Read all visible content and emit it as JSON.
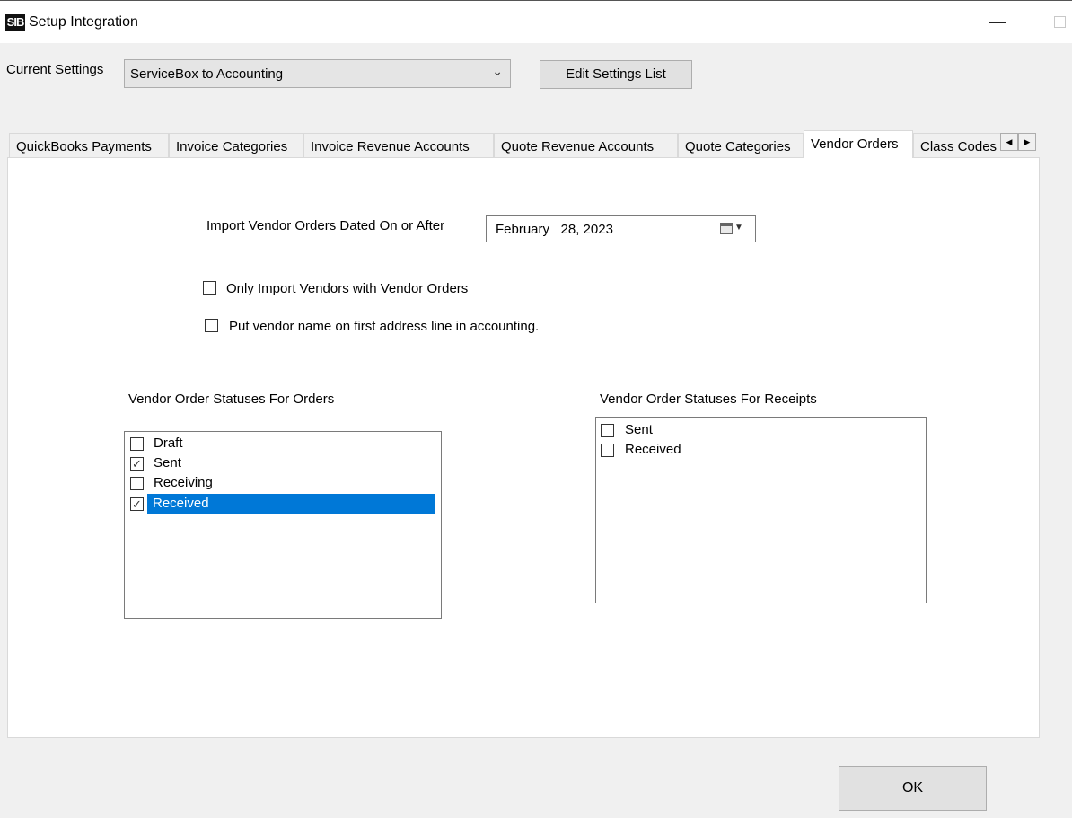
{
  "window": {
    "logo": "SIB",
    "title": "Setup Integration",
    "minimize_glyph": "—"
  },
  "settings": {
    "label": "Current Settings",
    "selected": "ServiceBox to Accounting",
    "edit_button": "Edit Settings List"
  },
  "tabs": [
    {
      "label": "QuickBooks Payments"
    },
    {
      "label": "Invoice Categories"
    },
    {
      "label": "Invoice Revenue Accounts"
    },
    {
      "label": "Quote Revenue Accounts"
    },
    {
      "label": "Quote Categories"
    },
    {
      "label": "Vendor Orders",
      "active": true
    },
    {
      "label": "Class Codes"
    }
  ],
  "vendor_orders": {
    "import_date_label": "Import Vendor Orders Dated On or After",
    "import_date_value": "February   28, 2023",
    "only_import_label": "Only Import Vendors with Vendor Orders",
    "only_import_checked": false,
    "put_vendor_label": "Put vendor name on first address line in accounting.",
    "put_vendor_checked": false,
    "orders_heading": "Vendor Order Statuses For Orders",
    "orders_items": [
      {
        "label": "Draft",
        "checked": false
      },
      {
        "label": "Sent",
        "checked": true
      },
      {
        "label": "Receiving",
        "checked": false
      },
      {
        "label": "Received",
        "checked": true,
        "selected": true
      }
    ],
    "receipts_heading": "Vendor Order Statuses For Receipts",
    "receipts_items": [
      {
        "label": "Sent",
        "checked": false
      },
      {
        "label": "Received",
        "checked": false
      }
    ]
  },
  "ok_button": "OK",
  "colors": {
    "selection": "#0078d7",
    "window_bg": "#f0f0f0"
  }
}
